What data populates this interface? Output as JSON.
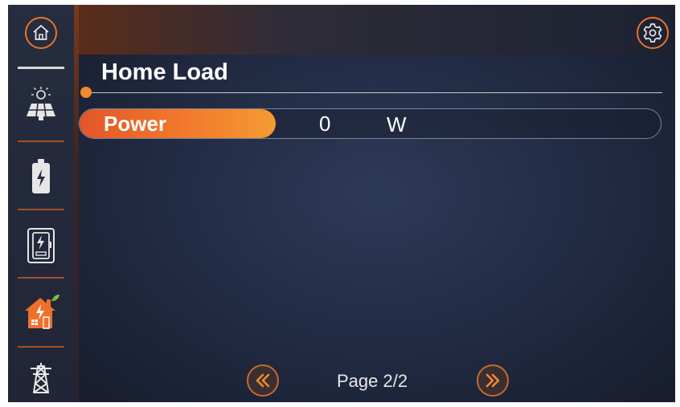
{
  "sidebar": {
    "items": [
      {
        "icon": "home-icon"
      },
      {
        "icon": "solar-panel-icon"
      },
      {
        "icon": "battery-icon"
      },
      {
        "icon": "inverter-icon"
      },
      {
        "icon": "home-load-icon",
        "active": true
      },
      {
        "icon": "power-grid-icon"
      }
    ]
  },
  "header": {
    "settings_icon": "gear-icon"
  },
  "main": {
    "title": "Home Load",
    "rows": [
      {
        "label": "Power",
        "value": "0",
        "unit": "W"
      }
    ]
  },
  "pager": {
    "prev_icon": "double-chevron-left-icon",
    "next_icon": "double-chevron-right-icon",
    "label": "Page 2/2"
  },
  "colors": {
    "accent": "#f08a2c",
    "sidebar_bg": "#232a3a",
    "content_bg": "#222b44"
  }
}
